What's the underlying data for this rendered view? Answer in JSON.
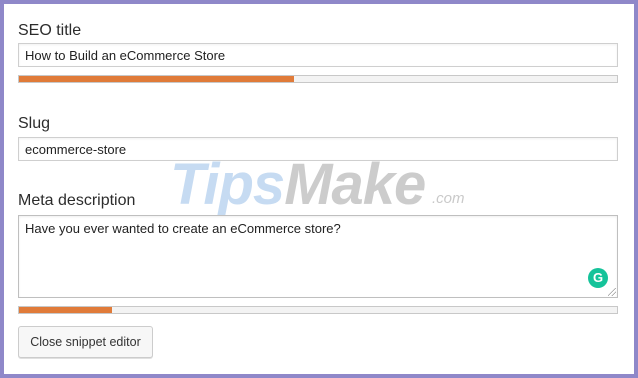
{
  "seo_title": {
    "label": "SEO title",
    "value": "How to Build an eCommerce Store",
    "progress": 0.46
  },
  "slug": {
    "label": "Slug",
    "value": "ecommerce-store"
  },
  "meta_description": {
    "label": "Meta description",
    "value": "Have you ever wanted to create an eCommerce store?",
    "progress": 0.155
  },
  "grammarly_icon": "grammarly-icon",
  "grammarly_glyph": "G",
  "close_button_label": "Close snippet editor",
  "watermark": {
    "part1": "Tips",
    "part2": "Make",
    "suffix": ".com"
  },
  "colors": {
    "progress_fill": "#e07b39",
    "frame_border": "#8f88c9",
    "grammarly": "#15c39a"
  }
}
